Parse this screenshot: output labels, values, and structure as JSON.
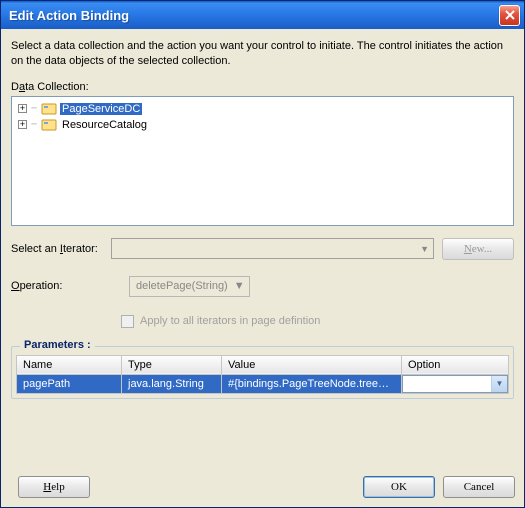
{
  "title": "Edit Action Binding",
  "instruction": "Select a data collection and the action you want your control to initiate. The control initiates the action on the data objects of the selected collection.",
  "dataCollectionLabel_pre": "D",
  "dataCollectionLabel_u": "a",
  "dataCollectionLabel_post": "ta Collection:",
  "tree": {
    "items": [
      {
        "label": "PageServiceDC",
        "selected": true,
        "icon": "dc"
      },
      {
        "label": "ResourceCatalog",
        "selected": false,
        "icon": "dc"
      }
    ]
  },
  "iteratorLabel_pre": "Select an ",
  "iteratorLabel_u": "I",
  "iteratorLabel_post": "terator:",
  "iteratorValue": "",
  "newBtn_u": "N",
  "newBtn_post": "ew...",
  "opLabel_u": "O",
  "opLabel_post": "peration:",
  "opValue": "deletePage(String)",
  "applyLabel": "Apply to all iterators in page defintion",
  "paramsLegend": "Parameters :",
  "paramsHeaders": {
    "name": "Name",
    "type": "Type",
    "value": "Value",
    "option": "Option"
  },
  "paramsRows": [
    {
      "name": "pagePath",
      "type": "java.lang.String",
      "value": "#{bindings.PageTreeNode.treeM...",
      "option": ""
    }
  ],
  "helpBtn_u": "H",
  "helpBtn_post": "elp",
  "okBtn": "OK",
  "cancelBtn": "Cancel"
}
